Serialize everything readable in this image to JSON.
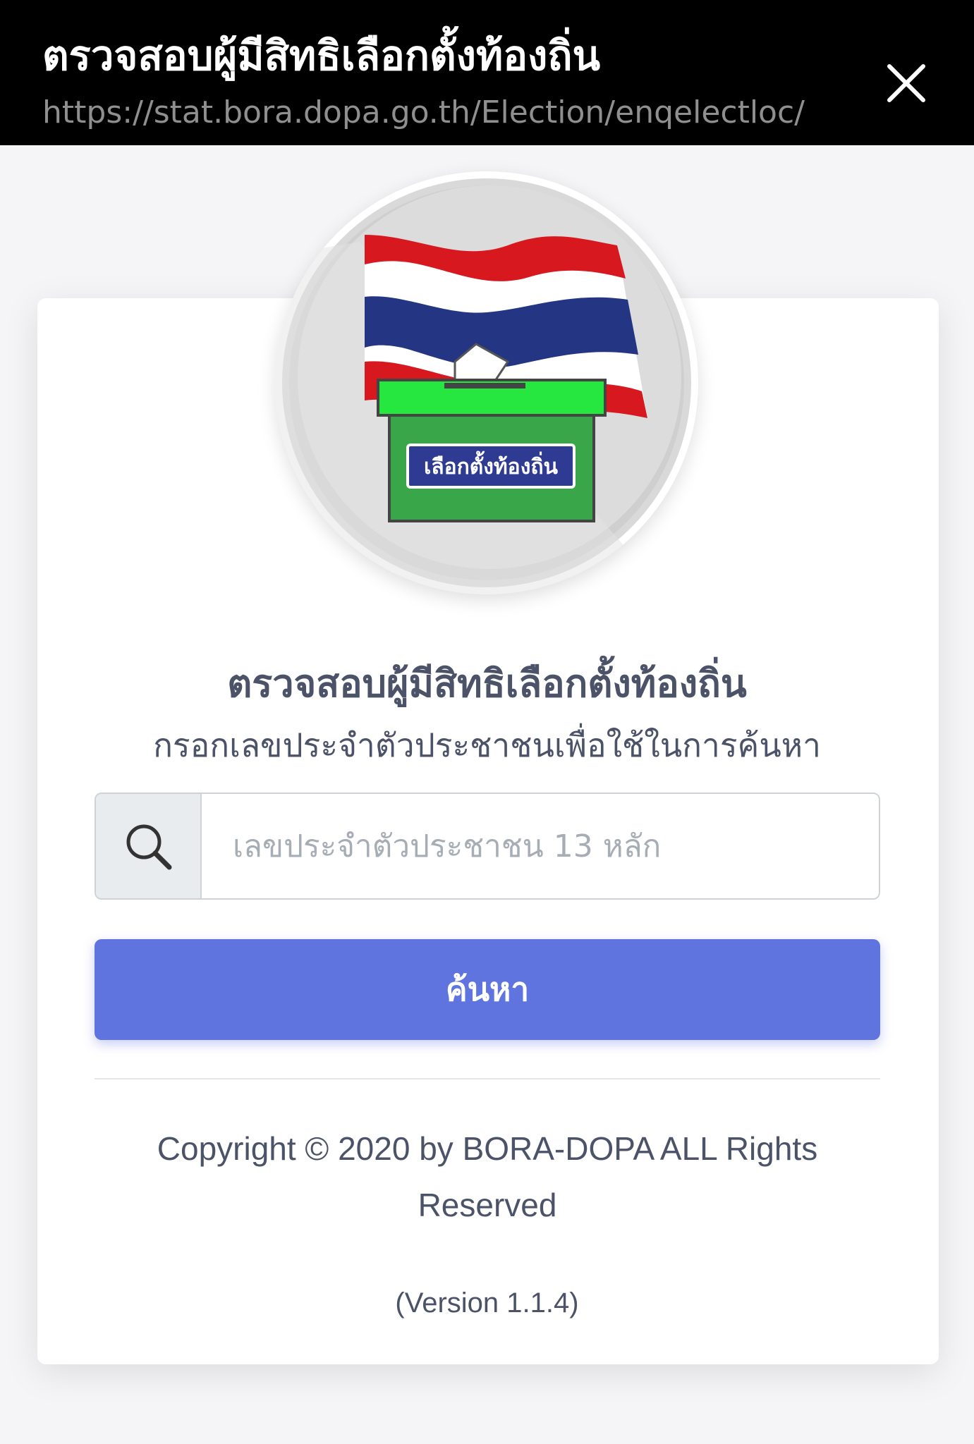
{
  "topbar": {
    "title": "ตรวจสอบผู้มีสิทธิเลือกตั้งท้องถิ่น",
    "url": "https://stat.bora.dopa.go.th/Election/enqelectloc/",
    "close_icon": "close-icon"
  },
  "logo": {
    "ballot_label": "เลือกตั้งท้องถิ่น",
    "colors": {
      "flag_red": "#d7191f",
      "flag_white": "#ffffff",
      "flag_blue": "#233583",
      "box_green": "#3aa64a",
      "box_lid_green": "#26e640",
      "label_blue": "#2f3a93"
    }
  },
  "main": {
    "heading": "ตรวจสอบผู้มีสิทธิเลือกตั้งท้องถิ่น",
    "subheading": "กรอกเลขประจำตัวประชาชนเพื่อใช้ในการค้นหา",
    "search_icon": "search-icon",
    "input_value": "",
    "input_placeholder": "เลขประจำตัวประชาชน 13 หลัก",
    "search_button_label": "ค้นหา",
    "copyright": "Copyright © 2020 by BORA-DOPA ALL Rights Reserved",
    "version": "(Version 1.1.4)"
  },
  "colors": {
    "topbar_bg": "#000000",
    "button_bg": "#6074e0",
    "text_primary": "#4c5368"
  }
}
